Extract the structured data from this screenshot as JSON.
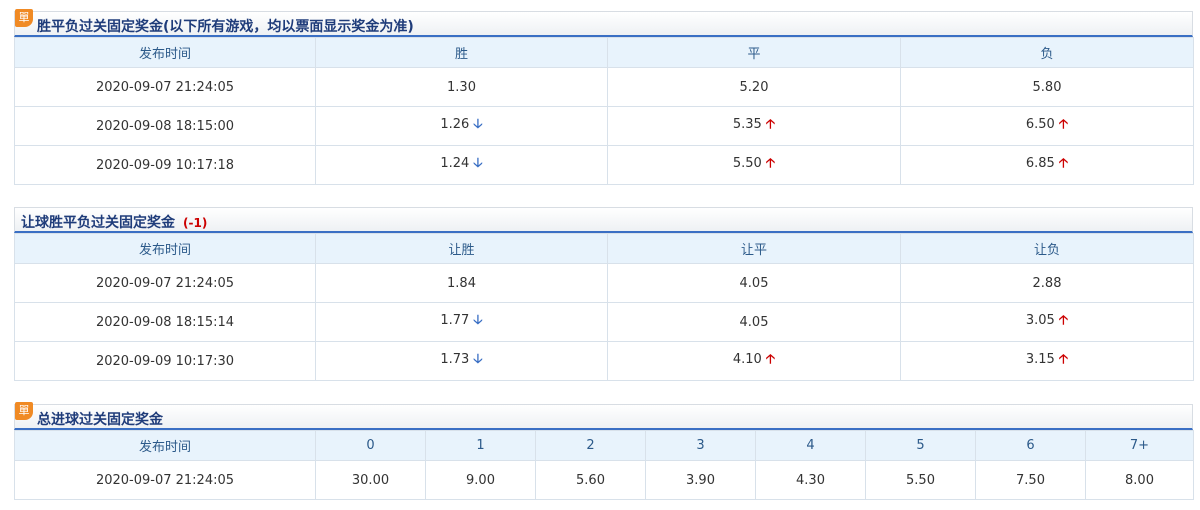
{
  "sections": [
    {
      "badge": "單",
      "title": "胜平负过关固定奖金(以下所有游戏，均以票面显示奖金为准)",
      "columns": [
        "发布时间",
        "胜",
        "平",
        "负"
      ],
      "rows": [
        {
          "time": "2020-09-07 21:24:05",
          "cells": [
            {
              "v": "1.30",
              "t": ""
            },
            {
              "v": "5.20",
              "t": ""
            },
            {
              "v": "5.80",
              "t": ""
            }
          ]
        },
        {
          "time": "2020-09-08 18:15:00",
          "cells": [
            {
              "v": "1.26",
              "t": "down"
            },
            {
              "v": "5.35",
              "t": "up"
            },
            {
              "v": "6.50",
              "t": "up"
            }
          ]
        },
        {
          "time": "2020-09-09 10:17:18",
          "cells": [
            {
              "v": "1.24",
              "t": "down"
            },
            {
              "v": "5.50",
              "t": "up"
            },
            {
              "v": "6.85",
              "t": "up"
            }
          ]
        }
      ]
    },
    {
      "title": "让球胜平负过关固定奖金",
      "handicap": "(-1)",
      "columns": [
        "发布时间",
        "让胜",
        "让平",
        "让负"
      ],
      "rows": [
        {
          "time": "2020-09-07 21:24:05",
          "cells": [
            {
              "v": "1.84",
              "t": ""
            },
            {
              "v": "4.05",
              "t": ""
            },
            {
              "v": "2.88",
              "t": ""
            }
          ]
        },
        {
          "time": "2020-09-08 18:15:14",
          "cells": [
            {
              "v": "1.77",
              "t": "down"
            },
            {
              "v": "4.05",
              "t": ""
            },
            {
              "v": "3.05",
              "t": "up"
            }
          ]
        },
        {
          "time": "2020-09-09 10:17:30",
          "cells": [
            {
              "v": "1.73",
              "t": "down"
            },
            {
              "v": "4.10",
              "t": "up"
            },
            {
              "v": "3.15",
              "t": "up"
            }
          ]
        }
      ]
    },
    {
      "badge": "單",
      "title": "总进球过关固定奖金",
      "columns": [
        "发布时间",
        "0",
        "1",
        "2",
        "3",
        "4",
        "5",
        "6",
        "7+"
      ],
      "rows": [
        {
          "time": "2020-09-07 21:24:05",
          "cells": [
            {
              "v": "30.00",
              "t": ""
            },
            {
              "v": "9.00",
              "t": ""
            },
            {
              "v": "5.60",
              "t": ""
            },
            {
              "v": "3.90",
              "t": ""
            },
            {
              "v": "4.30",
              "t": ""
            },
            {
              "v": "5.50",
              "t": ""
            },
            {
              "v": "7.50",
              "t": ""
            },
            {
              "v": "8.00",
              "t": ""
            }
          ]
        }
      ]
    }
  ],
  "icons": {
    "up": "arrow-up-icon",
    "down": "arrow-down-icon"
  },
  "colors": {
    "up": "#cc0000",
    "down": "#3a6fc4",
    "header_bg": "#e8f3fc",
    "title": "#1f3c7a",
    "badge": "#f08a24"
  }
}
